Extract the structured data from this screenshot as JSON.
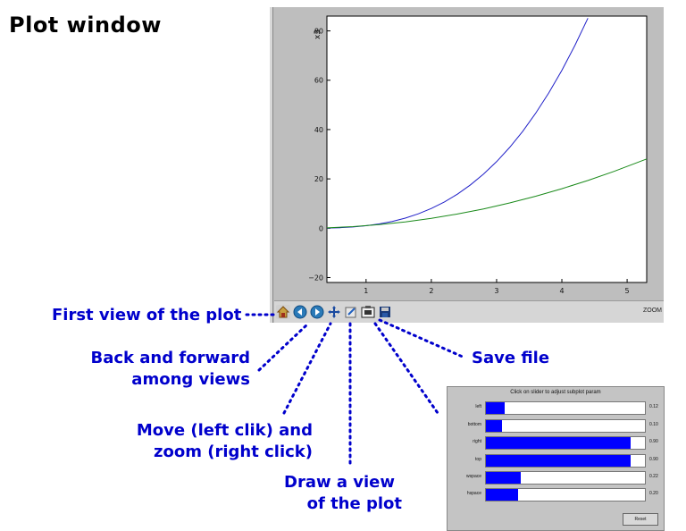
{
  "title": "Plot window",
  "plot": {
    "axis_labels": {
      "y_ticks": [
        "80",
        "60",
        "40",
        "20",
        "0",
        "−20"
      ],
      "x_ticks": [
        "1",
        "2",
        "3",
        "4",
        "5"
      ],
      "corner": "x3"
    }
  },
  "chart_data": {
    "type": "line",
    "xlim": [
      0.4,
      5.3
    ],
    "ylim": [
      -22,
      86
    ],
    "series": [
      {
        "x": [
          0.4,
          0.6,
          0.8,
          1.0,
          1.2,
          1.4,
          1.6,
          1.8,
          2.0,
          2.2,
          2.4,
          2.6,
          2.8,
          3.0,
          3.2,
          3.4,
          3.6,
          3.8,
          4.0,
          4.2,
          4.4
        ],
        "y": [
          0.06,
          0.22,
          0.51,
          1.0,
          1.73,
          2.74,
          4.1,
          5.83,
          8.0,
          10.65,
          13.82,
          17.58,
          21.95,
          27.0,
          32.77,
          39.3,
          46.66,
          54.87,
          64.0,
          74.09,
          85.18
        ],
        "color": "#2020c8"
      },
      {
        "x": [
          0.4,
          0.8,
          1.2,
          1.6,
          2.0,
          2.4,
          2.8,
          3.2,
          3.6,
          4.0,
          4.4,
          4.8,
          5.3
        ],
        "y": [
          0.16,
          0.64,
          1.44,
          2.56,
          4.0,
          5.76,
          7.84,
          10.24,
          12.96,
          16.0,
          19.36,
          23.04,
          28.09
        ],
        "color": "#1a8a1a"
      }
    ]
  },
  "toolbar": {
    "zoom_label": "ZOOM",
    "icons": [
      "home-icon",
      "back-icon",
      "forward-icon",
      "pan-icon",
      "configure-icon",
      "subplot-icon",
      "save-icon"
    ]
  },
  "annotations": {
    "first_view": "First view of the plot",
    "back_forward": [
      "Back and forward",
      "among views"
    ],
    "save_file": "Save file",
    "move_zoom": [
      "Move (left clik) and",
      "zoom (right click)"
    ],
    "draw_view": [
      "Draw a view",
      "of the plot"
    ]
  },
  "subplot_window": {
    "title": "Click on slider to adjust subplot param",
    "sliders": [
      {
        "label": "left",
        "value": "0.12",
        "fraction": 0.12
      },
      {
        "label": "bottom",
        "value": "0.10",
        "fraction": 0.1
      },
      {
        "label": "right",
        "value": "0.90",
        "fraction": 0.91
      },
      {
        "label": "top",
        "value": "0.90",
        "fraction": 0.91
      },
      {
        "label": "wspace",
        "value": "0.22",
        "fraction": 0.22
      },
      {
        "label": "hspace",
        "value": "0.20",
        "fraction": 0.2
      }
    ],
    "reset_label": "Reset"
  },
  "colors": {
    "annotation": "#0000cc",
    "slider_fill": "#0000ff",
    "series_1": "#2020c8",
    "series_2": "#1a8a1a"
  }
}
